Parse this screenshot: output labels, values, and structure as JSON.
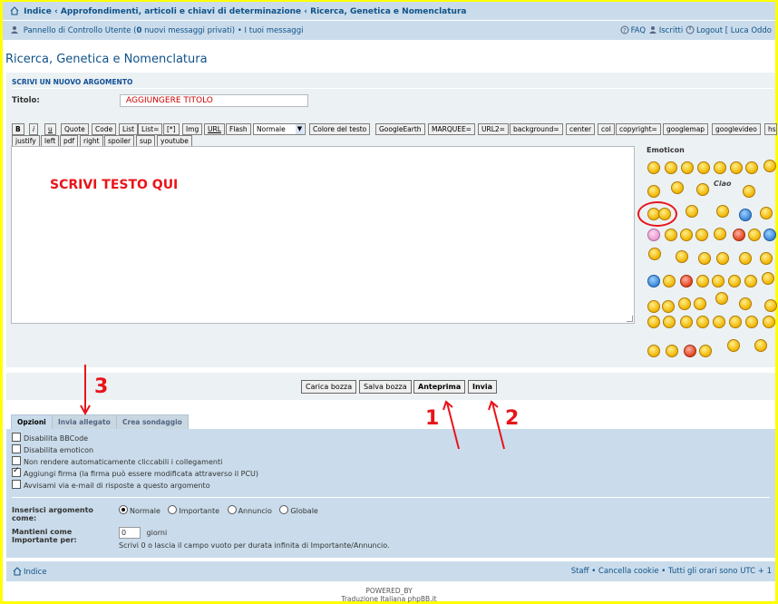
{
  "navbar": {
    "breadcrumb": [
      "Indice",
      "Approfondimenti, articoli e chiavi di determinazione",
      "Ricerca, Genetica e Nomenclatura"
    ],
    "ucp_label": "Pannello di Controllo Utente",
    "ucp_count_prefix": "(",
    "ucp_count": "0",
    "ucp_count_suffix": " nuovi messaggi privati)",
    "my_posts": "• I tuoi messaggi",
    "faq": "FAQ",
    "register": "Iscritti",
    "logout": "Logout [ Luca Oddo"
  },
  "page_title": "Ricerca, Genetica e Nomenclatura",
  "compose": {
    "header": "SCRIVI UN NUOVO ARGOMENTO",
    "title_label": "Titolo:",
    "title_value": "AGGIUNGERE TITOLO",
    "body_placeholder_text": "SCRIVI TESTO QUI",
    "toolbar_row1": [
      "B",
      "i",
      "u",
      "Quote",
      "Code",
      "List",
      "List=",
      "[*]",
      "Img",
      "URL",
      "Flash"
    ],
    "font_size_select": "Normale",
    "toolbar_row1b": [
      "Colore del testo",
      "GoogleEarth",
      "MARQUEE=",
      "URL2=",
      "background=",
      "center",
      "col",
      "copyright=",
      "googlemap",
      "googlevideo",
      "hs"
    ],
    "toolbar_row2": [
      "justify",
      "left",
      "pdf",
      "right",
      "spoiler",
      "sup",
      "youtube"
    ],
    "emoticons_label": "Emoticon"
  },
  "buttons": {
    "save_draft_load": "Carica bozza",
    "save_draft": "Salva bozza",
    "preview": "Anteprima",
    "submit": "Invia"
  },
  "annotations": {
    "n1": "1",
    "n2": "2",
    "n3": "3"
  },
  "tabs": [
    "Opzioni",
    "Invia allegato",
    "Crea sondaggio"
  ],
  "options": {
    "checkboxes": [
      {
        "label": "Disabilita BBCode",
        "checked": false
      },
      {
        "label": "Disabilita emoticon",
        "checked": false
      },
      {
        "label": "Non rendere automaticamente cliccabili i collegamenti",
        "checked": false
      },
      {
        "label": "Aggiungi firma (la firma può essere modificata attraverso il PCU)",
        "checked": true
      },
      {
        "label": "Avvisami via e-mail di risposte a questo argomento",
        "checked": false
      }
    ],
    "post_type_label": "Inserisci argomento come:",
    "post_types": [
      "Normale",
      "Importante",
      "Annuncio",
      "Globale"
    ],
    "sticky_label": "Mantieni come Importante per:",
    "sticky_value": "0",
    "sticky_unit": "giorni",
    "sticky_hint": "Scrivi 0 o lascia il campo vuoto per durata infinita di Importante/Annuncio."
  },
  "footer": {
    "index": "Indice",
    "right": "Staff • Cancella cookie • Tutti gli orari sono UTC + 1",
    "powered": "POWERED_BY",
    "translation": "Traduzione Italiana phpBB.it"
  },
  "colors": {
    "annotation_red": "#e8141b",
    "frame_yellow": "#ffff00",
    "nav_blue": "#cadceb"
  }
}
